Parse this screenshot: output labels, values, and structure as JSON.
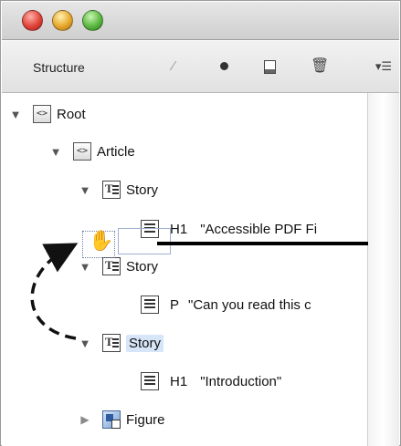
{
  "window": {
    "traffic_lights": [
      "close",
      "minimize",
      "zoom"
    ]
  },
  "panel": {
    "title": "Structure",
    "toolbar_icons": [
      "magic-wand-icon",
      "record-dot-icon",
      "page-icon",
      "trash-icon",
      "panel-menu-icon"
    ],
    "menu_glyph": "▾☰"
  },
  "tree": {
    "root": {
      "label": "Root",
      "expanded": true
    },
    "article": {
      "label": "Article",
      "expanded": true
    },
    "story1": {
      "label": "Story",
      "expanded": true
    },
    "h1_1": {
      "tag": "H1",
      "text": "\"Accessible PDF Fi"
    },
    "story2": {
      "label": "Story",
      "expanded": true
    },
    "p1": {
      "tag": "P",
      "text": "\"Can you read this c"
    },
    "story3": {
      "label": "Story",
      "expanded": true,
      "selected": true
    },
    "h1_2": {
      "tag": "H1",
      "text": "\"Introduction\""
    },
    "figure": {
      "label": "Figure",
      "expanded": false
    }
  },
  "colors": {
    "selection": "#d6e5f8",
    "drop_line": "#000000",
    "close": "#e0443a",
    "minimize": "#e7a92d",
    "zoom": "#5cb842"
  }
}
